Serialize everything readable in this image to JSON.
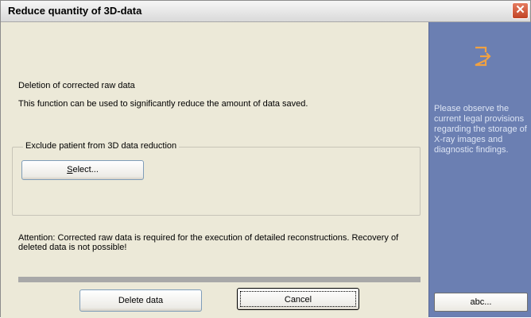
{
  "dialog": {
    "title": "Reduce quantity of 3D-data",
    "close_label": "✕"
  },
  "main": {
    "heading": "Deletion of corrected raw data",
    "description": "This function can be used to significantly reduce the amount of data saved.",
    "group_label": "Exclude patient from 3D data reduction",
    "select_button": {
      "mnemonic": "S",
      "rest": "elect..."
    },
    "attention": "Attention: Corrected raw data is required for the execution of detailed reconstructions. Recovery of deleted data is not possible!",
    "delete_button": "Delete data",
    "cancel_button": "Cancel"
  },
  "side_panel": {
    "icon": "exit-door-icon",
    "notice": "Please observe the current legal provisions regarding the storage of X-ray images and diagnostic findings.",
    "abc_button": "abc..."
  },
  "colors": {
    "dialog_bg": "#ece9d8",
    "side_bg": "#6b7fb2",
    "side_text": "#dce4f4",
    "icon_accent": "#f0a142",
    "close_red": "#c14425"
  }
}
